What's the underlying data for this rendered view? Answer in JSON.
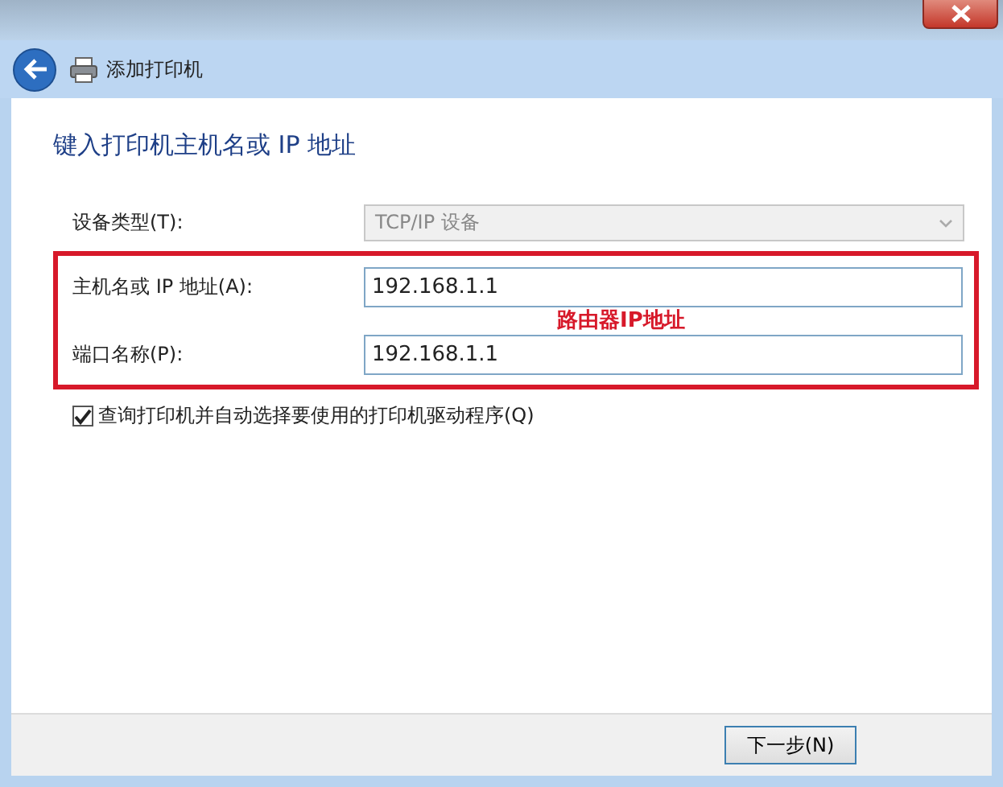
{
  "window": {
    "title": "添加打印机"
  },
  "heading": "键入打印机主机名或 IP 地址",
  "device_type": {
    "label": "设备类型(T):",
    "value": "TCP/IP 设备",
    "disabled": true
  },
  "annotation": {
    "text": "路由器IP地址",
    "fields": [
      {
        "label": "主机名或 IP 地址(A):",
        "value": "192.168.1.1"
      },
      {
        "label": "端口名称(P):",
        "value": "192.168.1.1"
      }
    ]
  },
  "checkbox": {
    "label": "查询打印机并自动选择要使用的打印机驱动程序(Q)",
    "checked": true
  },
  "buttons": [
    {
      "label": "下一步(N)"
    }
  ]
}
